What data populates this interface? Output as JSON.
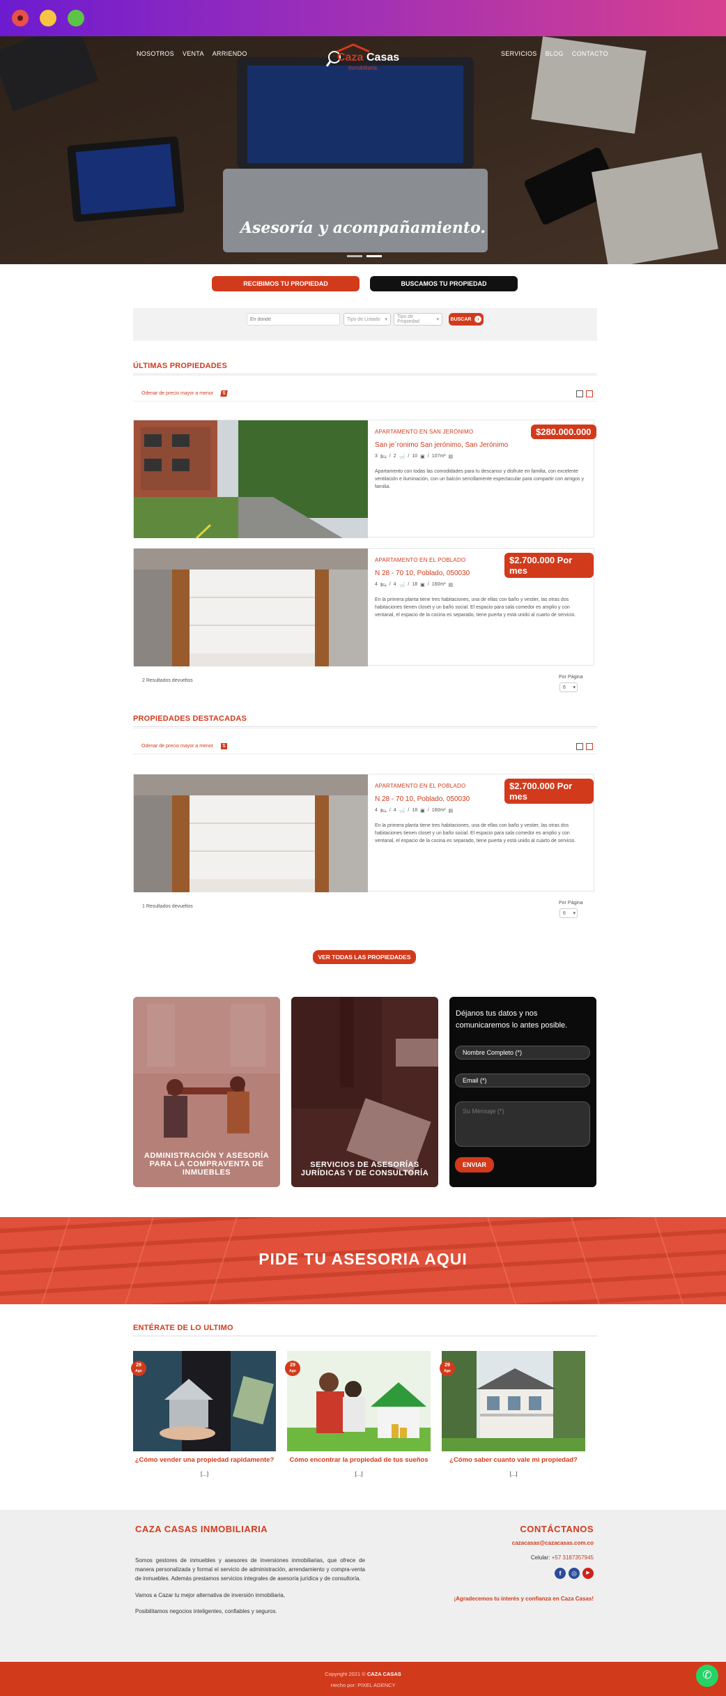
{
  "window": {
    "dots": [
      "#e8514a",
      "#f6c343",
      "#5cc545"
    ]
  },
  "nav": {
    "left": [
      "NOSOTROS",
      "VENTA",
      "ARRIENDO"
    ],
    "right": [
      "SERVICIOS",
      "BLOG",
      "CONTACTO"
    ],
    "logo_a": "Caza",
    "logo_b": "Casas",
    "logo_sub": "Inmobiliaria"
  },
  "hero": {
    "caption": "Asesoría y acompañamiento."
  },
  "actions": {
    "receive": "RECIBIMOS TU PROPIEDAD",
    "search": "BUSCAMOS TU PROPIEDAD"
  },
  "search": {
    "placeholder": "En donde",
    "listing_type": "Tipo de Listado",
    "property_type": "Tipo de Propiedad",
    "button": "BUSCAR"
  },
  "latest": {
    "title": "ÚLTIMAS PROPIEDADES",
    "sort": "Odenar de precio mayor a menor",
    "results": "2 Resultados devueltos",
    "per_page_label": "Por Página",
    "per_page": "6",
    "items": [
      {
        "title": "APARTAMENTO EN SAN JERÓNIMO",
        "address": "San je´ronimo San jerónimo, San Jerónimo",
        "price": "$280.000.000",
        "rooms": "3",
        "baths": "2",
        "photos": "10",
        "area": "107m²",
        "desc": "Apartamento con todas las comodidades para tu descanso y disfrute en familia, con excelente ventilación e iluminación, con un balcón sencillamente espectacular para compartir con amigos y familia."
      },
      {
        "title": "APARTAMENTO EN EL POBLADO",
        "address": "N 28 - 70 10, Poblado, 050030",
        "price": "$2.700.000 Por mes",
        "rooms": "4",
        "baths": "4",
        "photos": "18",
        "area": "160m²",
        "desc": "En la primera planta tiene tres habitaciones, una de ellas con baño y vestier, las otras dos habitaciones tienen closet y un baño social. El espacio para sala comedor es amplio y con ventanal, el espacio de la cocina es separado, tiene puerta y está unido al cuarto de servicio."
      }
    ]
  },
  "featured": {
    "title": "PROPIEDADES DESTACADAS",
    "sort": "Odenar de precio mayor a menor",
    "results": "1 Resultados devueltos",
    "per_page_label": "Por Página",
    "per_page": "6",
    "item": {
      "title": "APARTAMENTO EN EL POBLADO",
      "address": "N 28 - 70 10, Poblado, 050030",
      "price": "$2.700.000 Por mes",
      "rooms": "4",
      "baths": "4",
      "photos": "18",
      "area": "160m²",
      "desc": "En la primera planta tiene tres habitaciones, una de ellas con baño y vestier, las otras dos habitaciones tienen closet y un baño social. El espacio para sala comedor es amplio y con ventanal, el espacio de la cocina es separado, tiene puerta y está unido al cuarto de servicio."
    }
  },
  "see_all": "VER TODAS LAS PROPIEDADES",
  "services": {
    "one": "ADMINISTRACIÓN Y ASESORÍA PARA LA COMPRAVENTA DE INMUEBLES",
    "two": "SERVICIOS DE ASESORÍAS JURÍDICAS Y DE CONSULTORÍA"
  },
  "form": {
    "heading": "Déjanos tus datos y nos comunicaremos lo antes posible.",
    "name": "Nombre Completo (*)",
    "email": "Email (*)",
    "message": "Su Mensaje (*)",
    "submit": "ENVIAR"
  },
  "banner": "PIDE TU ASESORIA AQUI",
  "blog": {
    "title": "ENTÉRATE DE LO ULTIMO",
    "posts": [
      {
        "day": "29",
        "month": "Ago",
        "title": "¿Cómo vender una propiedad rapidamente?",
        "excerpt": "[...]"
      },
      {
        "day": "29",
        "month": "Ago",
        "title": "Cómo encontrar la propiedad de tus sueños",
        "excerpt": "[...]"
      },
      {
        "day": "29",
        "month": "Ago",
        "title": "¿Cómo saber cuanto vale mi propiedad?",
        "excerpt": "[...]"
      }
    ]
  },
  "footer": {
    "brand": "CAZA CASAS INMOBILIARIA",
    "p1": "Somos gestores de inmuebles y asesores de inversiones inmobiliarias, que ofrece de manera personalizada y formal el servicio de administración, arrendamiento y compra-venta de inmuebles. Además prestamos servicios integrales de asesoría jurídica y de consultoría.",
    "p2": "Vamos a Cazar tu mejor alternativa de inversión inmobiliaria,",
    "p3": "Posibilitamos negocios inteligentes, confiables y seguros.",
    "contact_title": "CONTÁCTANOS",
    "email": "cazacasas@cazacasas.com.co",
    "phone_label": "Celular:",
    "phone": "+57 3187357945",
    "thanks": "¡Agradecemos tu interés y confianza en Caza Casas!",
    "copyright_a": "Copyright 2021 ©",
    "copyright_b": "CAZA CASAS",
    "made_by": "Hecho por: PIXEL AGENCY"
  },
  "colors": {
    "accent": "#d23a1c",
    "dark": "#111111"
  }
}
